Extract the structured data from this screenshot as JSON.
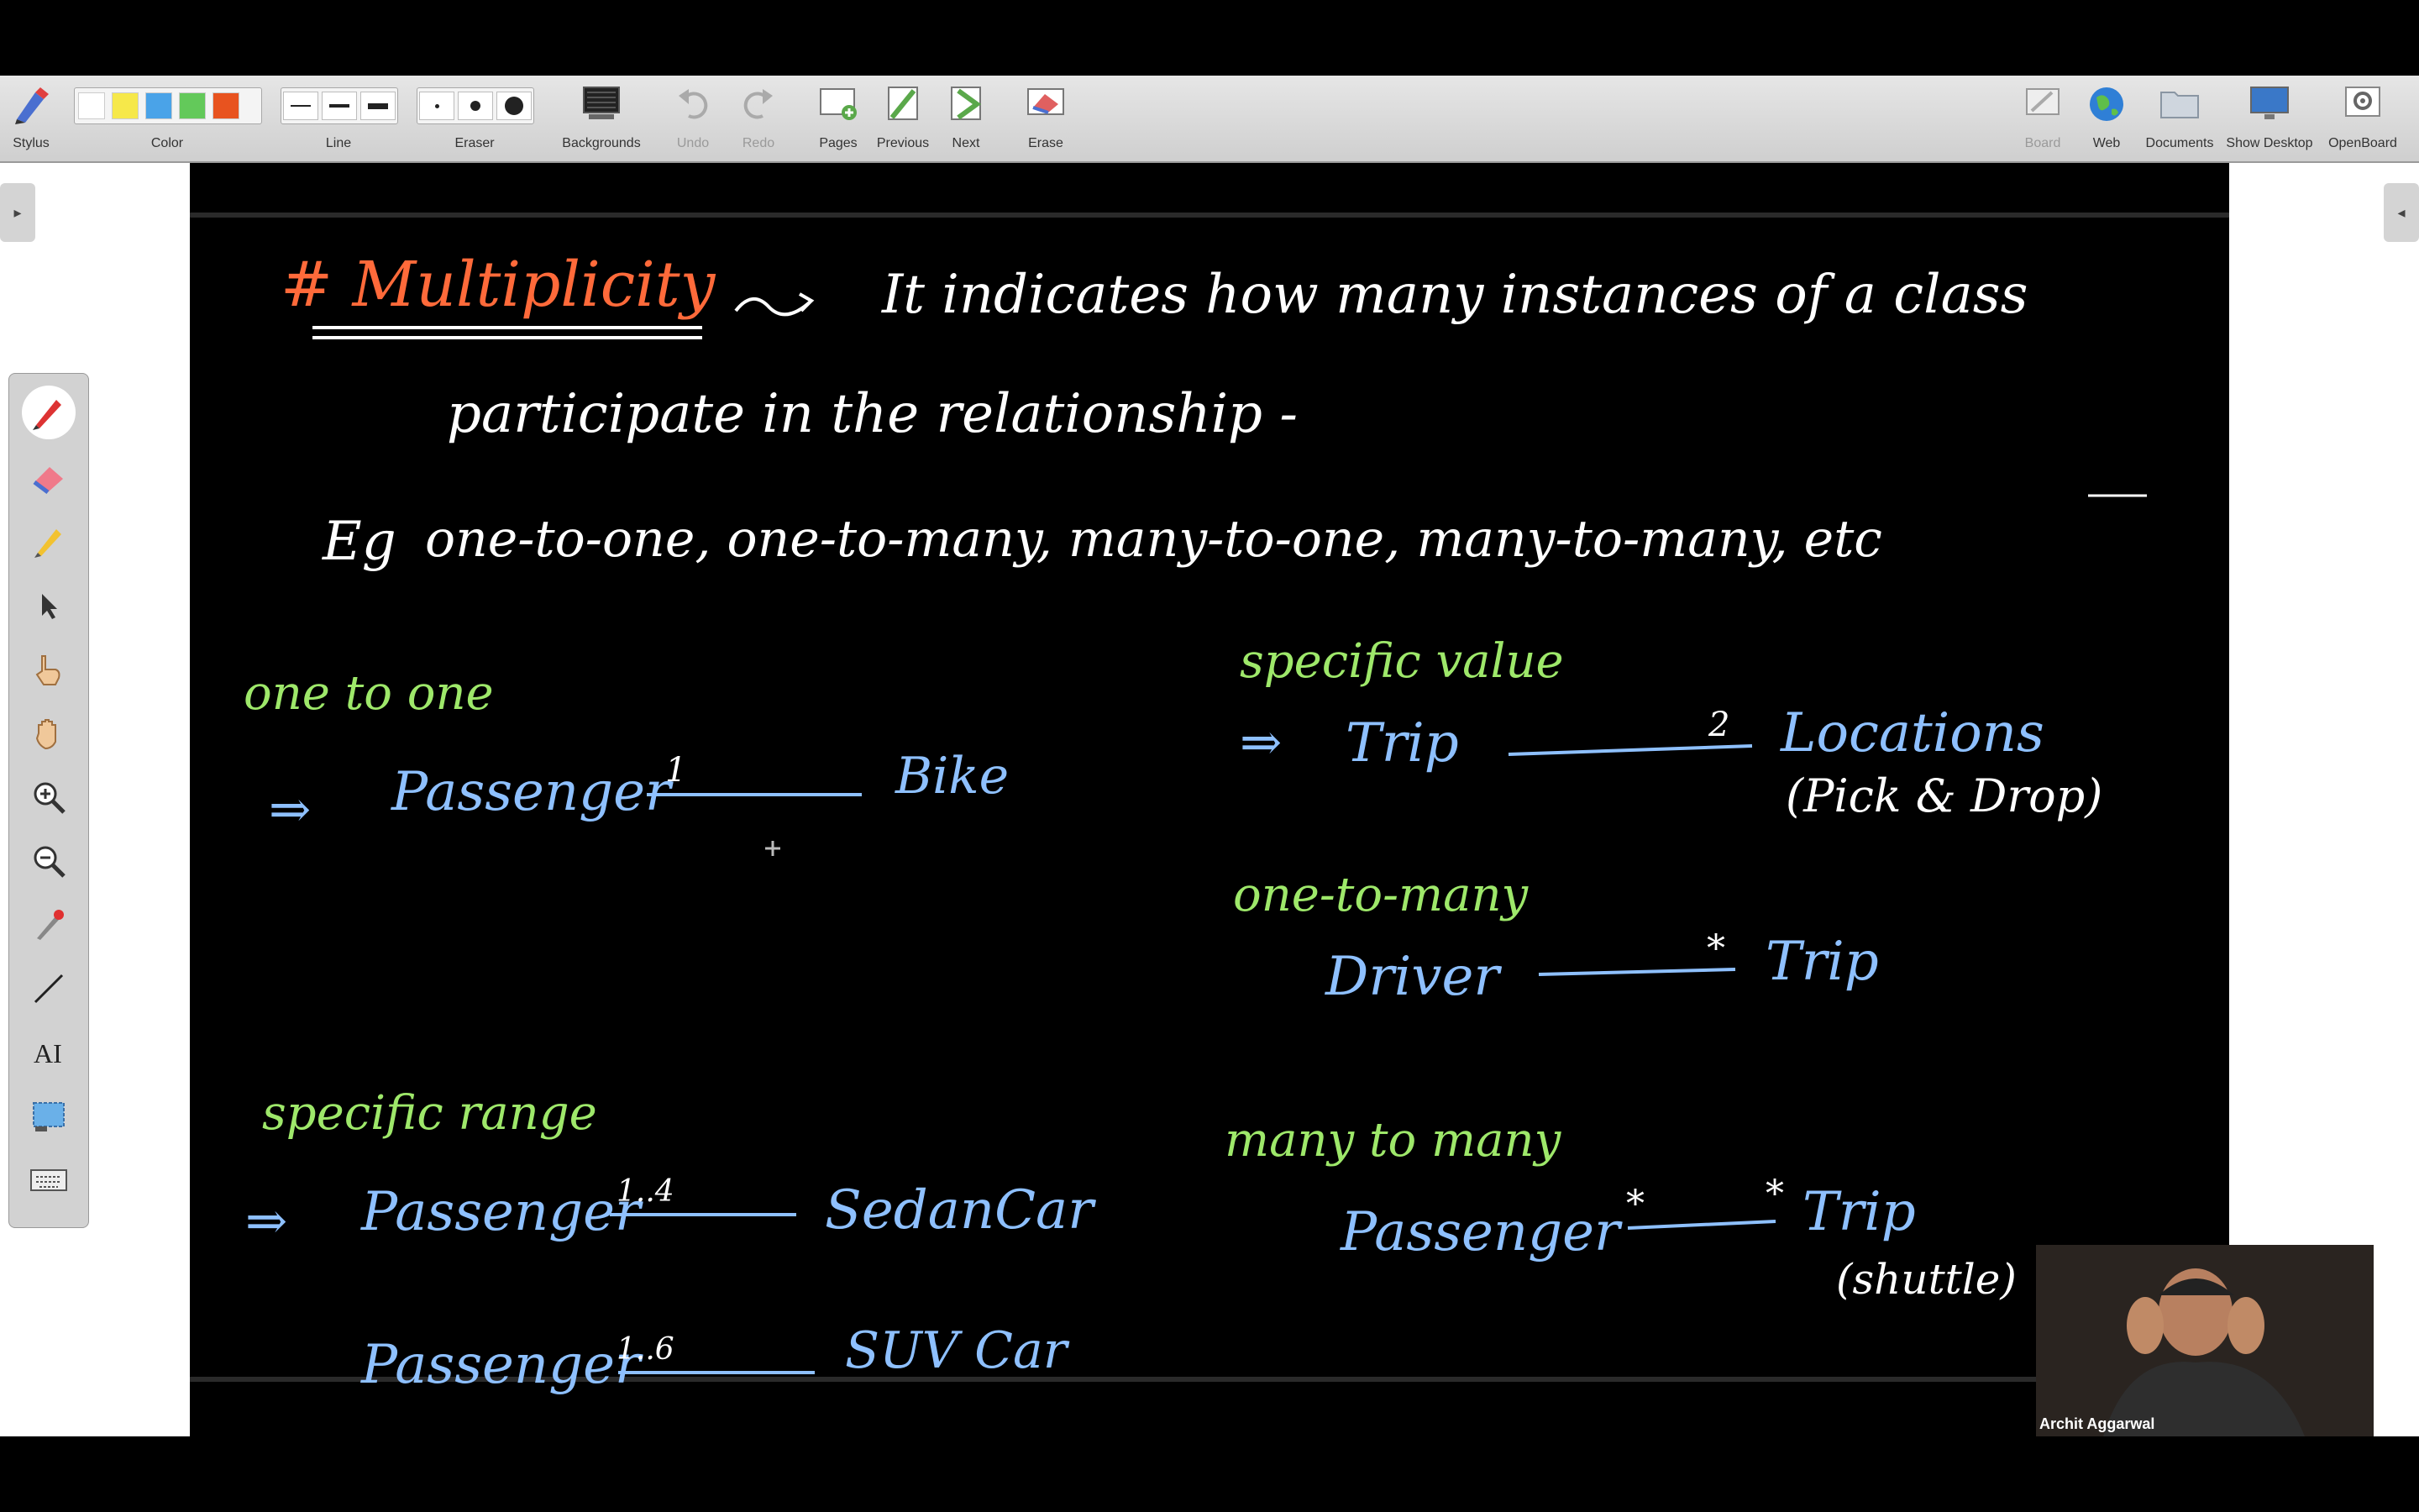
{
  "toolbar": {
    "stylus": "Stylus",
    "color": "Color",
    "line": "Line",
    "eraser": "Eraser",
    "backgrounds": "Backgrounds",
    "undo": "Undo",
    "redo": "Redo",
    "pages": "Pages",
    "previous": "Previous",
    "next": "Next",
    "erase": "Erase",
    "board": "Board",
    "web": "Web",
    "documents": "Documents",
    "show_desktop": "Show Desktop",
    "openboard": "OpenBoard"
  },
  "colors": {
    "swatches": [
      "#ffffff",
      "#f6e84a",
      "#4aa3e8",
      "#63c95a",
      "#e8531f"
    ],
    "title": "#ff6a3a",
    "text": "#ffffff",
    "green": "#9ee86a",
    "blue": "#8ec0ff"
  },
  "board": {
    "heading": "# Multiplicity",
    "definition_line1": "It indicates how many instances of a class",
    "definition_line2": "participate in the relationship -",
    "eg_label": "Eg",
    "examples": "one-to-one, one-to-many, many-to-one, many-to-many, etc",
    "one_to_one": {
      "title": "one to one",
      "arrow": "⇒",
      "left": "Passenger",
      "mult": "1",
      "right": "Bike"
    },
    "specific_range": {
      "title": "specific range",
      "arrow": "⇒",
      "row1": {
        "left": "Passenger",
        "mult": "1..4",
        "right": "SedanCar"
      },
      "row2": {
        "left": "Passenger",
        "mult": "1..6",
        "right": "SUV Car"
      }
    },
    "specific_value": {
      "title": "specific value",
      "arrow": "⇒",
      "left": "Trip",
      "mult": "2",
      "right": "Locations",
      "note": "(Pick & Drop)"
    },
    "one_to_many": {
      "title": "one-to-many",
      "left": "Driver",
      "mult": "*",
      "right": "Trip"
    },
    "many_to_many": {
      "title": "many to many",
      "left": "Passenger",
      "mult_left": "*",
      "mult_right": "*",
      "right": "Trip",
      "note": "(shuttle)"
    }
  },
  "webcam": {
    "name": "Archit Aggarwal"
  }
}
